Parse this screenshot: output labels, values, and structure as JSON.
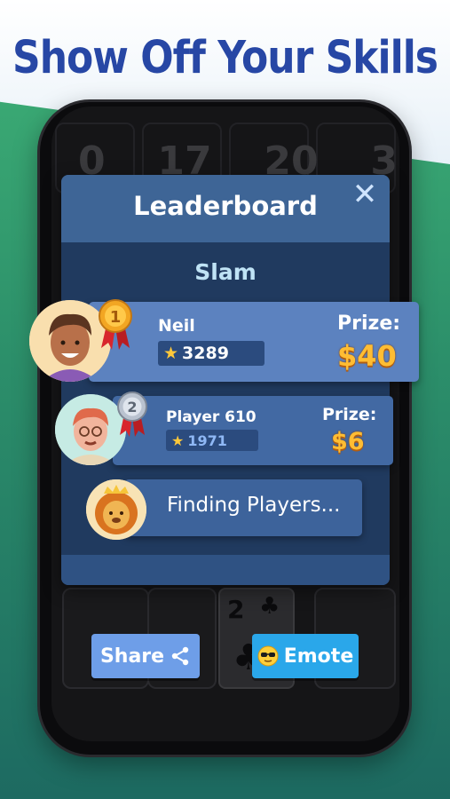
{
  "headline": "Show Off Your Skills",
  "background_numbers": [
    "0",
    "17",
    "20",
    "3"
  ],
  "modal": {
    "title": "Leaderboard",
    "close_glyph": "✕",
    "mode": "Slam"
  },
  "players": [
    {
      "rank": "1",
      "name": "Neil",
      "score": "3289",
      "prize_label": "Prize:",
      "prize": "$40"
    },
    {
      "rank": "2",
      "name": "Player 610",
      "score": "1971",
      "prize_label": "Prize:",
      "prize": "$6"
    }
  ],
  "finding_text": "Finding Players...",
  "hand_card": {
    "rank": "2",
    "suit": "♣"
  },
  "buttons": {
    "share": "Share",
    "emote": "Emote",
    "emote_emoji": "😎"
  },
  "colors": {
    "headline": "#2747a5",
    "prize": "#ffbd33",
    "gold_medal": "#f2a623",
    "silver_medal": "#b9c2cf"
  },
  "icons": [
    "close-icon",
    "star-icon",
    "share-icon",
    "gold-medal-icon",
    "silver-medal-icon",
    "sunglasses-emoji-icon",
    "club-suit-icon"
  ]
}
